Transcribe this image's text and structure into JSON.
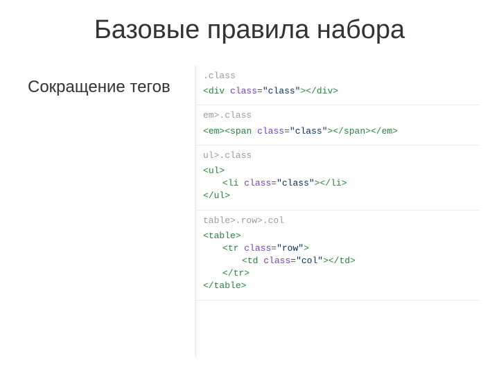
{
  "title": "Базовые правила набора",
  "subtitle": "Сокращение тегов",
  "groups": [
    {
      "abbr": ".class",
      "lines": [
        {
          "indent": 0,
          "tokens": [
            {
              "t": "bracket",
              "v": "<"
            },
            {
              "t": "tag",
              "v": "div"
            },
            {
              "t": "plain",
              "v": " "
            },
            {
              "t": "attr-name",
              "v": "class"
            },
            {
              "t": "attr-eq",
              "v": "="
            },
            {
              "t": "attr-val",
              "v": "\"class\""
            },
            {
              "t": "bracket",
              "v": "></"
            },
            {
              "t": "tag",
              "v": "div"
            },
            {
              "t": "bracket",
              "v": ">"
            }
          ]
        }
      ]
    },
    {
      "abbr": "em>.class",
      "lines": [
        {
          "indent": 0,
          "tokens": [
            {
              "t": "bracket",
              "v": "<"
            },
            {
              "t": "tag",
              "v": "em"
            },
            {
              "t": "bracket",
              "v": ">"
            },
            {
              "t": "bracket",
              "v": "<"
            },
            {
              "t": "tag",
              "v": "span"
            },
            {
              "t": "plain",
              "v": " "
            },
            {
              "t": "attr-name",
              "v": "class"
            },
            {
              "t": "attr-eq",
              "v": "="
            },
            {
              "t": "attr-val",
              "v": "\"class\""
            },
            {
              "t": "bracket",
              "v": "></"
            },
            {
              "t": "tag",
              "v": "span"
            },
            {
              "t": "bracket",
              "v": ">"
            },
            {
              "t": "bracket",
              "v": "</"
            },
            {
              "t": "tag",
              "v": "em"
            },
            {
              "t": "bracket",
              "v": ">"
            }
          ]
        }
      ]
    },
    {
      "abbr": "ul>.class",
      "lines": [
        {
          "indent": 0,
          "tokens": [
            {
              "t": "bracket",
              "v": "<"
            },
            {
              "t": "tag",
              "v": "ul"
            },
            {
              "t": "bracket",
              "v": ">"
            }
          ]
        },
        {
          "indent": 1,
          "tokens": [
            {
              "t": "bracket",
              "v": "<"
            },
            {
              "t": "tag",
              "v": "li"
            },
            {
              "t": "plain",
              "v": " "
            },
            {
              "t": "attr-name",
              "v": "class"
            },
            {
              "t": "attr-eq",
              "v": "="
            },
            {
              "t": "attr-val",
              "v": "\"class\""
            },
            {
              "t": "bracket",
              "v": "></"
            },
            {
              "t": "tag",
              "v": "li"
            },
            {
              "t": "bracket",
              "v": ">"
            }
          ]
        },
        {
          "indent": 0,
          "tokens": [
            {
              "t": "bracket",
              "v": "</"
            },
            {
              "t": "tag",
              "v": "ul"
            },
            {
              "t": "bracket",
              "v": ">"
            }
          ]
        }
      ]
    },
    {
      "abbr": "table>.row>.col",
      "lines": [
        {
          "indent": 0,
          "tokens": [
            {
              "t": "bracket",
              "v": "<"
            },
            {
              "t": "tag",
              "v": "table"
            },
            {
              "t": "bracket",
              "v": ">"
            }
          ]
        },
        {
          "indent": 1,
          "tokens": [
            {
              "t": "bracket",
              "v": "<"
            },
            {
              "t": "tag",
              "v": "tr"
            },
            {
              "t": "plain",
              "v": " "
            },
            {
              "t": "attr-name",
              "v": "class"
            },
            {
              "t": "attr-eq",
              "v": "="
            },
            {
              "t": "attr-val",
              "v": "\"row\""
            },
            {
              "t": "bracket",
              "v": ">"
            }
          ]
        },
        {
          "indent": 2,
          "tokens": [
            {
              "t": "bracket",
              "v": "<"
            },
            {
              "t": "tag",
              "v": "td"
            },
            {
              "t": "plain",
              "v": " "
            },
            {
              "t": "attr-name",
              "v": "class"
            },
            {
              "t": "attr-eq",
              "v": "="
            },
            {
              "t": "attr-val",
              "v": "\"col\""
            },
            {
              "t": "bracket",
              "v": "></"
            },
            {
              "t": "tag",
              "v": "td"
            },
            {
              "t": "bracket",
              "v": ">"
            }
          ]
        },
        {
          "indent": 1,
          "tokens": [
            {
              "t": "bracket",
              "v": "</"
            },
            {
              "t": "tag",
              "v": "tr"
            },
            {
              "t": "bracket",
              "v": ">"
            }
          ]
        },
        {
          "indent": 0,
          "tokens": [
            {
              "t": "bracket",
              "v": "</"
            },
            {
              "t": "tag",
              "v": "table"
            },
            {
              "t": "bracket",
              "v": ">"
            }
          ]
        }
      ]
    }
  ]
}
